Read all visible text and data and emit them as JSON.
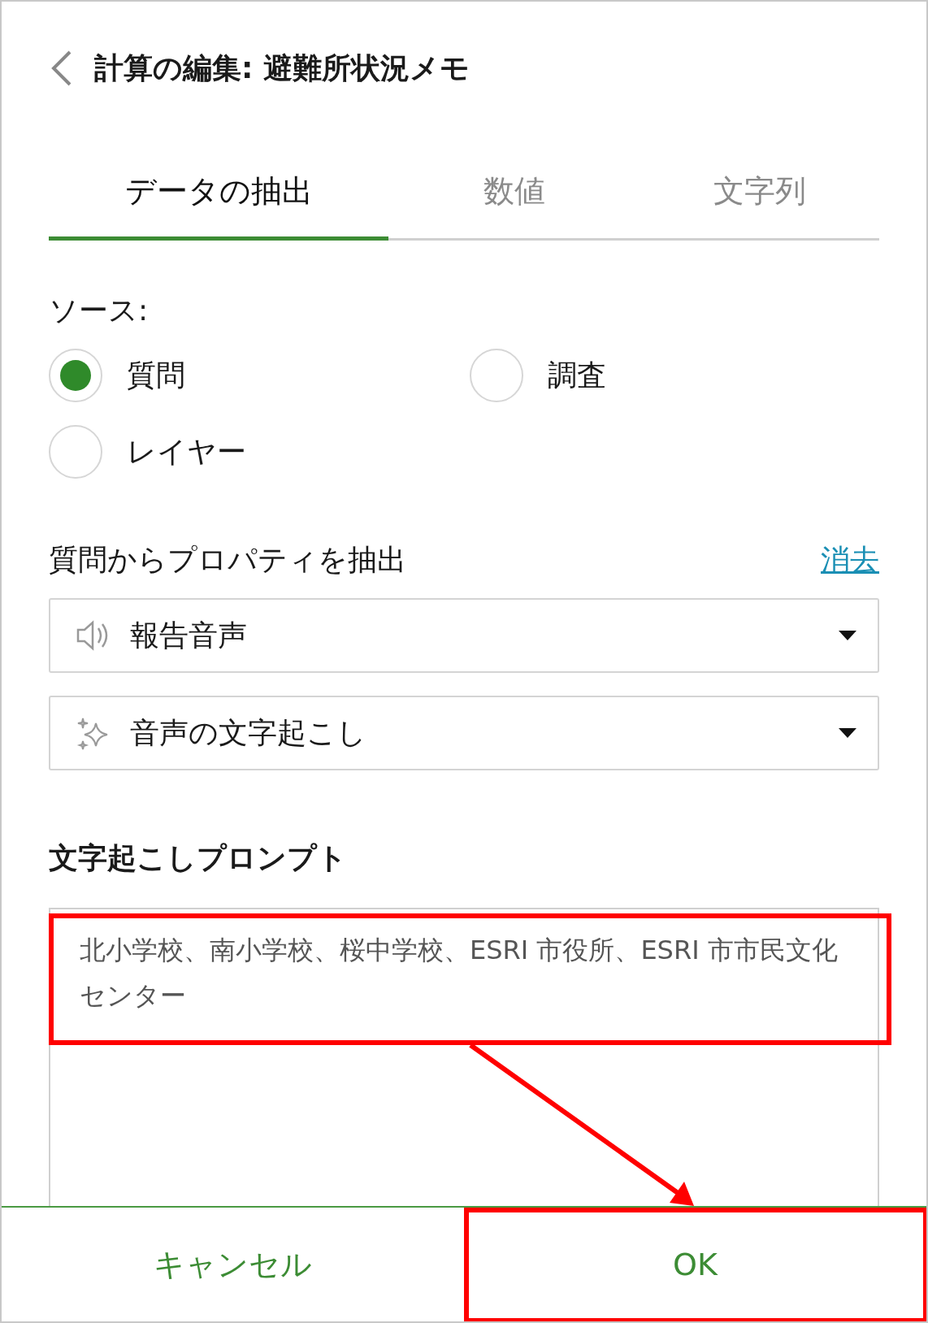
{
  "header": {
    "title": "計算の編集: 避難所状況メモ"
  },
  "tabs": [
    {
      "label": "データの抽出",
      "selected": true
    },
    {
      "label": "数値",
      "selected": false
    },
    {
      "label": "文字列",
      "selected": false
    }
  ],
  "source": {
    "label": "ソース:",
    "options": [
      {
        "label": "質問",
        "selected": true
      },
      {
        "label": "調査",
        "selected": false
      },
      {
        "label": "レイヤー",
        "selected": false
      }
    ]
  },
  "extract": {
    "label": "質問からプロパティを抽出",
    "clear_link": "消去",
    "dropdowns": [
      {
        "value": "報告音声",
        "kind": "audio"
      },
      {
        "value": "音声の文字起こし",
        "kind": "ai"
      }
    ]
  },
  "prompt": {
    "label": "文字起こしプロンプト",
    "value": "北小学校、南小学校、桜中学校、ESRI 市役所、ESRI 市市民文化センター"
  },
  "footer": {
    "buttons": [
      "キャンセル",
      "OK"
    ]
  }
}
